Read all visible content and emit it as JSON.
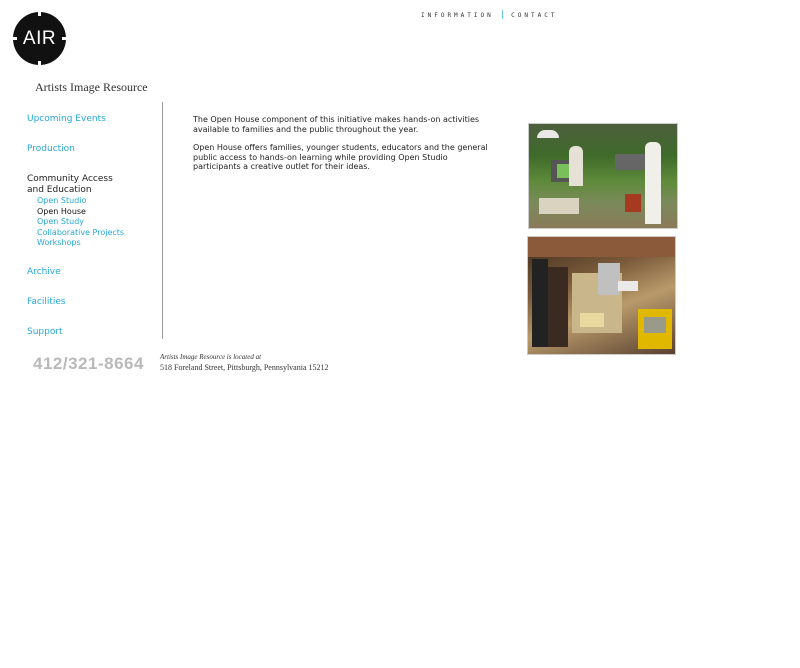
{
  "logo": {
    "text": "AIR"
  },
  "org_name": "Artists Image Resource",
  "topnav": {
    "information": "INFORMATION",
    "separator": "|",
    "contact": "CONTACT"
  },
  "sidebar": {
    "upcoming_events": "Upcoming Events",
    "production": "Production",
    "community_line1": "Community Access",
    "community_line2": "and Education",
    "subitems": [
      "Open Studio",
      "Open House",
      "Open Study",
      "Collaborative Projects",
      "Workshops"
    ],
    "archive": "Archive",
    "facilities": "Facilities",
    "support": "Support"
  },
  "content": {
    "paragraph1": "The Open House component of this initiative makes hands-on activities available to families and the public throughout the year.",
    "paragraph2": "Open House offers families, younger students, educators and the general public access to hands-on learning while providing Open Studio participants a creative outlet for their ideas."
  },
  "footer": {
    "phone": "412/321-8664",
    "located_at": "Artists Image Resource is located at",
    "address": "518 Foreland Street, Pittsburgh, Pennsylvania 15212"
  },
  "colors": {
    "link": "#27a7d6",
    "accent": "#3ab7d4",
    "phone": "#b9b9b9"
  }
}
